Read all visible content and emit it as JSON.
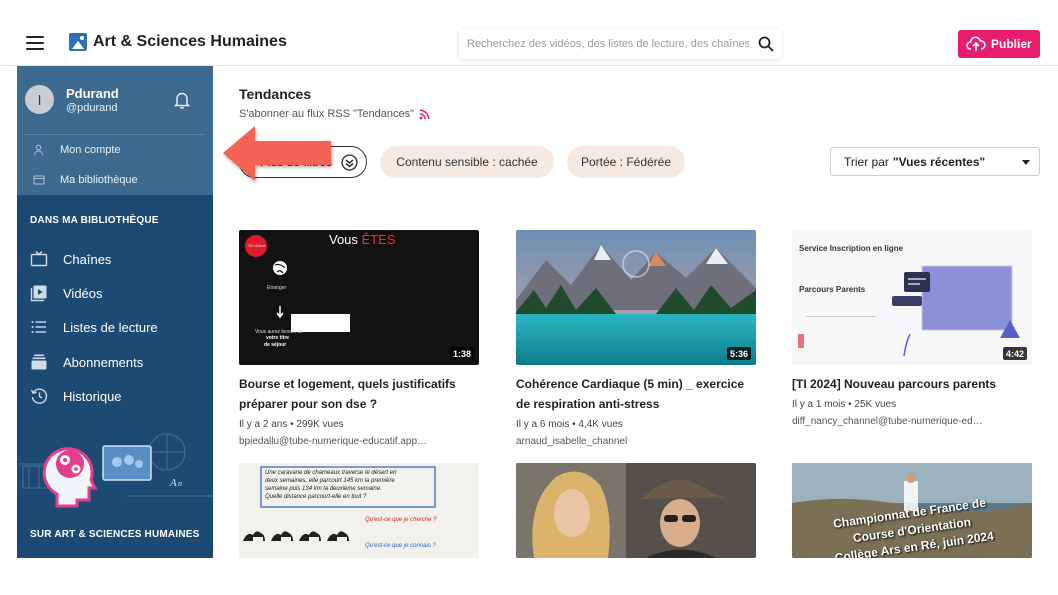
{
  "header": {
    "app_title": "Art & Sciences Humaines",
    "search_placeholder": "Recherchez des vidéos, des listes de lecture, des chaînes",
    "publish_label": "Publier"
  },
  "user": {
    "avatar_letter": "l",
    "name": "Pdurand",
    "handle": "@pdurand",
    "links": [
      {
        "label": "Mon compte",
        "icon": "user-icon"
      },
      {
        "label": "Ma bibliothèque",
        "icon": "folder-icon"
      }
    ]
  },
  "sidebar": {
    "library_section_title": "DANS MA BIBLIOTHÈQUE",
    "items": [
      {
        "label": "Chaînes",
        "icon": "tv-icon"
      },
      {
        "label": "Vidéos",
        "icon": "video-icon"
      },
      {
        "label": "Listes de lecture",
        "icon": "list-icon"
      },
      {
        "label": "Abonnements",
        "icon": "subscriptions-icon"
      },
      {
        "label": "Historique",
        "icon": "history-icon"
      }
    ],
    "about_section_title": "SUR ART & SCIENCES HUMAINES"
  },
  "main": {
    "page_title": "Tendances",
    "rss_label": "S'abonner au flux RSS \"Tendances\"",
    "filters": {
      "more_filters_label": "Plus de filtres",
      "sensitive_label": "Contenu sensible : cachée",
      "scope_label": "Portée : Fédérée"
    },
    "sort": {
      "label": "Trier par",
      "value": "\"Vues récentes\""
    }
  },
  "videos": [
    {
      "title": "Bourse et logement, quels justificatifs préparer pour son dse ?",
      "meta": "Il y a 2 ans • 299K vues",
      "channel": "bpiedallu@tube-numerique-educatif.app…",
      "duration": "1:38",
      "thumb_heading": "Vous ÊTES",
      "thumb_heading_highlight": "ÊTES",
      "thumb_badge": "En Grece",
      "thumb_caption_1": "Etranger",
      "thumb_caption_2": "Vous aurez besoin de",
      "thumb_caption_3": "votre titre",
      "thumb_caption_4": "de séjour"
    },
    {
      "title": "Cohérence Cardiaque (5 min) _ exercice de respiration anti-stress",
      "meta": "Il y a 6 mois • 4,4K vues",
      "channel": "arnaud_isabelle_channel",
      "duration": "5:36"
    },
    {
      "title": "[TI 2024] Nouveau parcours parents",
      "meta": "Il y a 1 mois • 25K vues",
      "channel": "diff_nancy_channel@tube-numerique-ed…",
      "duration": "4:42",
      "thumb_heading": "Service Inscription en ligne",
      "thumb_subheading": "Parcours Parents"
    },
    {
      "title": "",
      "thumb_line_1": "Une caravane de chameaux traverse le désert en",
      "thumb_line_2": "deux semaines, elle parcourt 145 km la première",
      "thumb_line_3": "semaine puis 134 km la deuxième semaine.",
      "thumb_line_4": "Quelle distance parcourt-elle en tout ?",
      "thumb_q1": "Qu'est-ce que je cherche ?",
      "thumb_q2": "Qu'est-ce que je connais ?"
    },
    {
      "title": ""
    },
    {
      "title": "",
      "thumb_line_1": "Championnat de France de",
      "thumb_line_2": "Course d'Orientation",
      "thumb_line_3": "Collège Ars en Ré, juin 2024"
    }
  ],
  "colors": {
    "sidebar_bg": "#1d4a72",
    "user_block_bg": "#3f6a90",
    "publish_bg": "#e81d6f",
    "pill_bg": "#f6e9df",
    "arrow": "#f26457"
  }
}
